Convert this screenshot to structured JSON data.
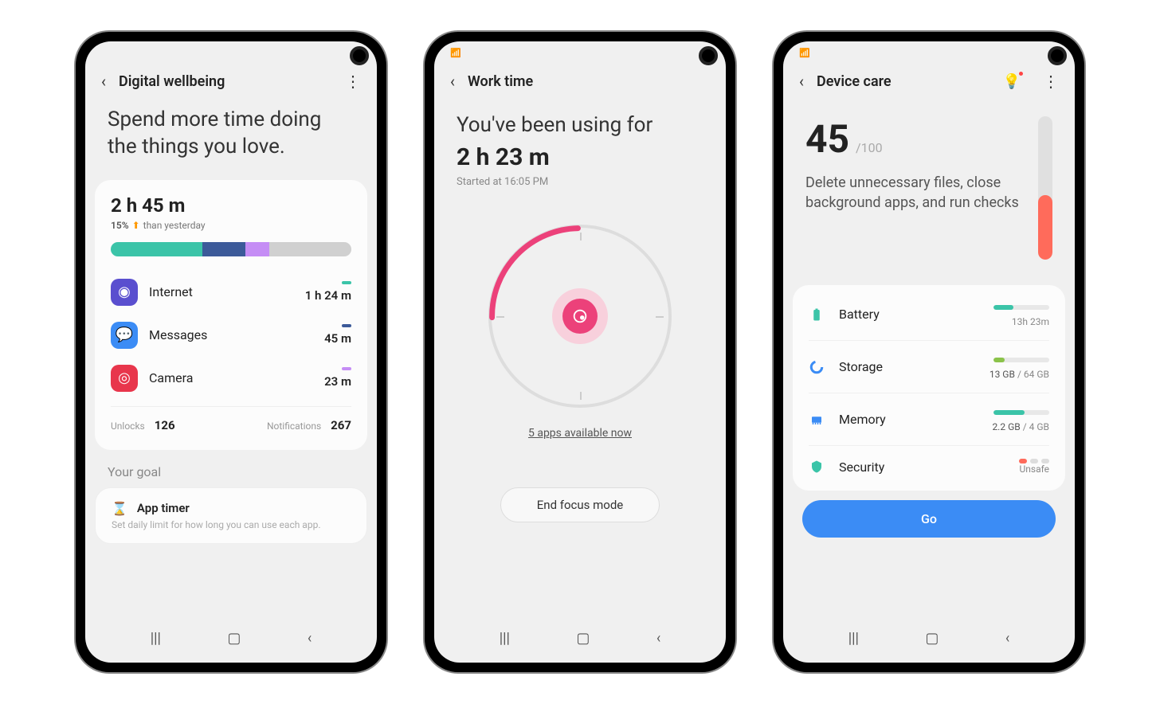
{
  "screen1": {
    "title": "Digital wellbeing",
    "hero": "Spend more time doing the things you love.",
    "total_time": "2 h 45 m",
    "compare_pct": "15%",
    "compare_text": "than yesterday",
    "usage_segments": [
      {
        "color": "#3bc4a8",
        "pct": 38
      },
      {
        "color": "#3c5a99",
        "pct": 18
      },
      {
        "color": "#c58df5",
        "pct": 10
      },
      {
        "color": "#d0d0d0",
        "pct": 34
      }
    ],
    "apps": [
      {
        "name": "Internet",
        "time": "1 h 24 m",
        "icon_bg": "#5a4fcf",
        "dot": "#3bc4a8"
      },
      {
        "name": "Messages",
        "time": "45 m",
        "icon_bg": "#3b8cf5",
        "dot": "#3c5a99"
      },
      {
        "name": "Camera",
        "time": "23 m",
        "icon_bg": "#e8364c",
        "dot": "#c58df5"
      }
    ],
    "unlocks_label": "Unlocks",
    "unlocks_val": "126",
    "notif_label": "Notifications",
    "notif_val": "267",
    "goal_section": "Your goal",
    "goal_title": "App timer",
    "goal_sub": "Set daily limit for how long you can use each app."
  },
  "screen2": {
    "title": "Work time",
    "hero": "You've been using for",
    "time": "2 h 23 m",
    "started": "Started at 16:05 PM",
    "apps_link": "5 apps available now",
    "end_btn": "End focus mode"
  },
  "screen3": {
    "title": "Device care",
    "score": "45",
    "score_max": "/100",
    "desc": "Delete unnecessary files, close background apps, and run checks",
    "score_pct": 45,
    "metrics": [
      {
        "name": "Battery",
        "icon": "battery",
        "color": "#3bc4a8",
        "fill": 35,
        "val": "13h 23m"
      },
      {
        "name": "Storage",
        "icon": "storage",
        "color": "#8bc34a",
        "fill": 20,
        "val_used": "13 GB",
        "val_total": "/ 64 GB"
      },
      {
        "name": "Memory",
        "icon": "memory",
        "color": "#3bc4a8",
        "fill": 55,
        "val_used": "2.2 GB",
        "val_total": "/ 4 GB"
      },
      {
        "name": "Security",
        "icon": "security",
        "color": "#ff6b5b",
        "val": "Unsafe"
      }
    ],
    "go_btn": "Go"
  }
}
